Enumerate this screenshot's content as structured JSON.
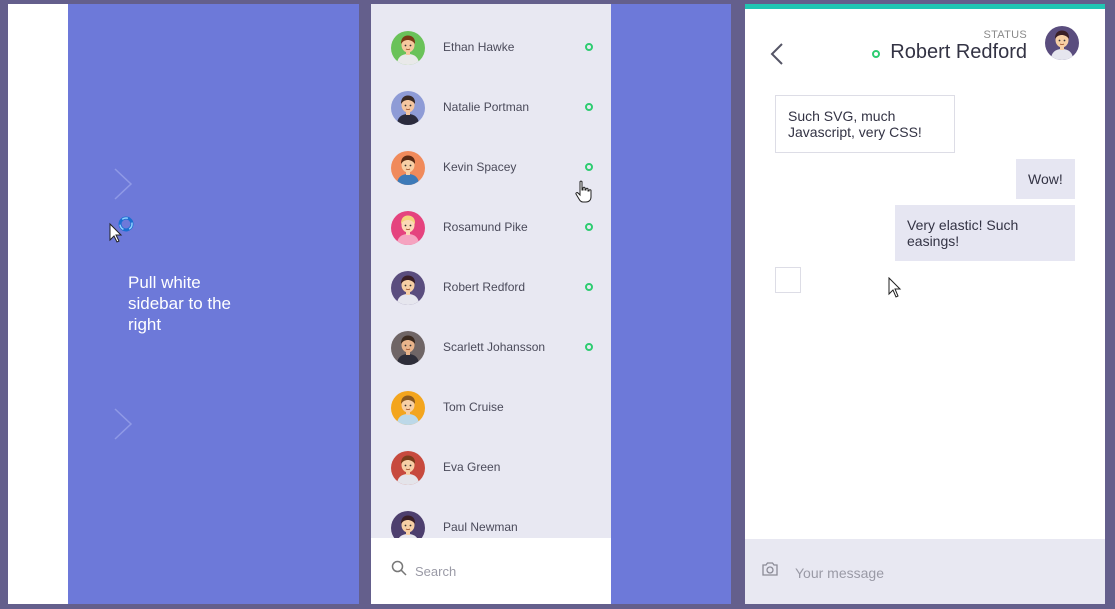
{
  "colors": {
    "background": "#645f8c",
    "panel_purple": "#6d79d9",
    "accent_teal": "#21c6b3",
    "online_green": "#2ecc71",
    "list_bg": "#e8e8f2"
  },
  "intro": {
    "hint_text": "Pull white sidebar to the right"
  },
  "contacts": [
    {
      "name": "Ethan Hawke",
      "online": true,
      "avatar_bg": "#6ac259",
      "hair": "#7a3b17",
      "skin": "#f6c89e",
      "shirt": "#e9e9e9"
    },
    {
      "name": "Natalie Portman",
      "online": true,
      "avatar_bg": "#8e9bd6",
      "hair": "#3a2a25",
      "skin": "#f5c6a0",
      "shirt": "#2b2b3d"
    },
    {
      "name": "Kevin Spacey",
      "online": true,
      "avatar_bg": "#f08a5b",
      "hair": "#5a2b16",
      "skin": "#f7cfa5",
      "shirt": "#3d7ab8"
    },
    {
      "name": "Rosamund Pike",
      "online": true,
      "avatar_bg": "#e5437e",
      "hair": "#f3d37c",
      "skin": "#fcd9b6",
      "shirt": "#f5a3c0"
    },
    {
      "name": "Robert Redford",
      "online": true,
      "avatar_bg": "#5a4d7e",
      "hair": "#3a1f26",
      "skin": "#f7cfa5",
      "shirt": "#e6e6ee"
    },
    {
      "name": "Scarlett Johansson",
      "online": true,
      "avatar_bg": "#6f6566",
      "hair": "#3b2a20",
      "skin": "#e9b48b",
      "shirt": "#2e2e3a"
    },
    {
      "name": "Tom Cruise",
      "online": false,
      "avatar_bg": "#f3a51e",
      "hair": "#8a5a22",
      "skin": "#f7cfa5",
      "shirt": "#bcd8e8"
    },
    {
      "name": "Eva Green",
      "online": false,
      "avatar_bg": "#c74a3e",
      "hair": "#7a3d1c",
      "skin": "#f7cfa5",
      "shirt": "#e4e4ea"
    },
    {
      "name": "Paul Newman",
      "online": false,
      "avatar_bg": "#4d3f6e",
      "hair": "#3a1f26",
      "skin": "#f7cfa5",
      "shirt": "#e6e6ee"
    }
  ],
  "search": {
    "placeholder": "Search"
  },
  "chat": {
    "status_label": "STATUS",
    "contact_name": "Robert Redford",
    "messages": [
      {
        "direction": "in",
        "text": "Such SVG, much Javascript, very CSS!"
      },
      {
        "direction": "out",
        "text": "Wow!"
      },
      {
        "direction": "out",
        "text": "Very elastic! Such easings!"
      }
    ],
    "composer_placeholder": "Your message"
  },
  "icons": {
    "chevron": "chevron-right-icon",
    "back": "chevron-left-icon",
    "search": "search-icon",
    "camera": "camera-icon"
  }
}
